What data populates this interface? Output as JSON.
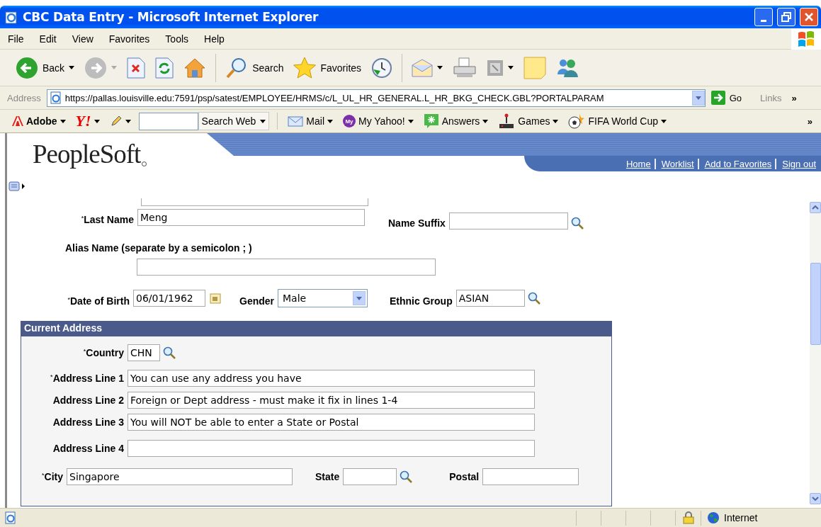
{
  "window": {
    "title": "CBC Data Entry - Microsoft Internet Explorer"
  },
  "menu": [
    "File",
    "Edit",
    "View",
    "Favorites",
    "Tools",
    "Help"
  ],
  "toolbar": [
    {
      "kind": "back",
      "label": "Back",
      "dropdown": true
    },
    {
      "kind": "forward",
      "dropdown": true
    },
    {
      "kind": "stop"
    },
    {
      "kind": "refresh"
    },
    {
      "kind": "home"
    },
    {
      "kind": "search",
      "label": "Search"
    },
    {
      "kind": "favorites",
      "label": "Favorites"
    },
    {
      "kind": "history"
    },
    {
      "kind": "mail",
      "dropdown": true
    },
    {
      "kind": "print"
    },
    {
      "kind": "edit",
      "dropdown": true
    },
    {
      "kind": "note"
    },
    {
      "kind": "messenger"
    }
  ],
  "address_bar": {
    "label": "Address",
    "value": "https://pallas.louisville.edu:7591/psp/satest/EMPLOYEE/HRMS/c/L_UL_HR_GENERAL.L_HR_BKG_CHECK.GBL?PORTALPARAM",
    "go": "Go",
    "links": "Links",
    "more": "»"
  },
  "links_bar": {
    "items": [
      {
        "kind": "adobe",
        "label": "Adobe",
        "dropdown": true
      },
      {
        "kind": "yahoo",
        "label": "Y!",
        "dropdown": true
      },
      {
        "kind": "pencil",
        "dropdown": true
      },
      {
        "kind": "search_box"
      },
      {
        "kind": "search_button",
        "label": "Search Web",
        "dropdown": true
      },
      {
        "kind": "mail",
        "label": "Mail",
        "dropdown": true
      },
      {
        "kind": "myyahoo",
        "badge": "My",
        "label": "My Yahoo!",
        "dropdown": true
      },
      {
        "kind": "answers",
        "label": "Answers",
        "dropdown": true
      },
      {
        "kind": "games",
        "label": "Games",
        "dropdown": true
      },
      {
        "kind": "fifa",
        "label": "FIFA World Cup",
        "dropdown": true
      }
    ],
    "more": "»"
  },
  "header": {
    "logo": "PeopleSoft",
    "links": [
      "Home",
      "Worklist",
      "Add to Favorites",
      "Sign out"
    ]
  },
  "person": {
    "last_name": {
      "label": "$^{*}$Last Name",
      "value": "Meng"
    },
    "name_suffix": {
      "label": "Name Suffix",
      "lookup": true
    },
    "alias": {
      "label": "Alias Name (separate by a semicolon ; )"
    },
    "date_of_birth": {
      "label": "$^{*}$Date of Birth",
      "value": "06/01/1962"
    },
    "gender": {
      "label": "Gender",
      "value": "Male"
    },
    "ethnic_group": {
      "label": "Ethnic Group",
      "value": "ASIAN",
      "lookup": true
    }
  },
  "current_address": {
    "title": "Current Address",
    "country": {
      "label": "$^{*}$Country",
      "value": "CHN",
      "lookup": true
    },
    "lines": [
      {
        "label": "$^{*}$Address Line 1",
        "value": "You can use any address you have"
      },
      {
        "label": "Address Line 2",
        "value": "Foreign or Dept address - must make it fix in lines 1-4"
      },
      {
        "label": "Address Line 3",
        "value": "You will NOT be able to enter a State or Postal"
      },
      {
        "label": "Address Line 4"
      }
    ],
    "city": {
      "label": "$^{*}$City",
      "value": "Singapore"
    },
    "state": {
      "label": "State",
      "lookup": true
    },
    "postal": {
      "label": "Postal"
    }
  },
  "status_bar": {
    "zone": "Internet"
  }
}
